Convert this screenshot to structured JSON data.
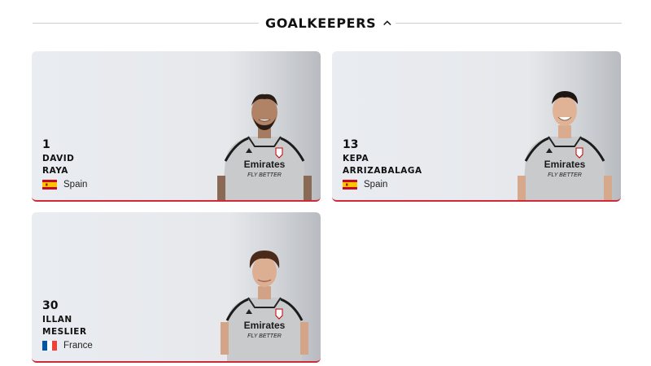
{
  "section": {
    "title": "GOALKEEPERS",
    "toggle_icon": "chevron-up-icon",
    "divider_color": "#cfcfcf"
  },
  "accent_color": "#d3283a",
  "players": [
    {
      "number": "1",
      "first_name": "DAVID",
      "last_name": "RAYA",
      "country": "Spain",
      "flag_icon": "spain-flag-icon",
      "shirt_sponsor": "Emirates",
      "shirt_tagline": "FLY BETTER"
    },
    {
      "number": "13",
      "first_name": "KEPA",
      "last_name": "ARRIZABALAGA",
      "country": "Spain",
      "flag_icon": "spain-flag-icon",
      "shirt_sponsor": "Emirates",
      "shirt_tagline": "FLY BETTER"
    },
    {
      "number": "30",
      "first_name": "ILLAN",
      "last_name": "MESLIER",
      "country": "France",
      "flag_icon": "france-flag-icon",
      "shirt_sponsor": "Emirates",
      "shirt_tagline": "FLY BETTER"
    }
  ]
}
